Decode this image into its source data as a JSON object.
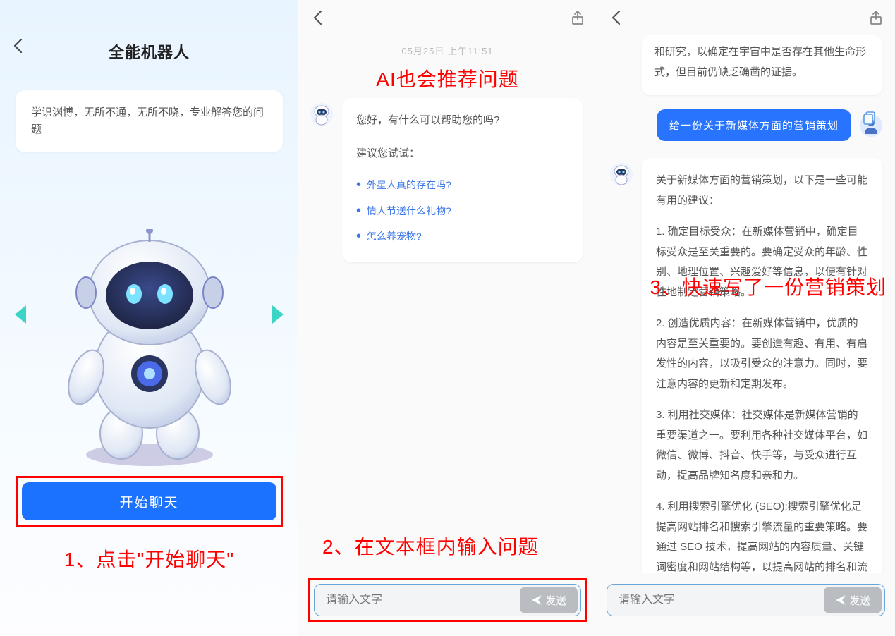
{
  "panel1": {
    "title": "全能机器人",
    "description": "学识渊博，无所不通，无所不晓，专业解答您的问题",
    "start_button": "开始聊天",
    "annotation": "1、点击\"开始聊天\""
  },
  "panel2": {
    "timestamp": "05月25日  上午11:51",
    "annotation_top": "AI也会推荐问题",
    "greeting": "您好，有什么可以帮助您的吗?",
    "try_label": "建议您试试：",
    "suggestions": [
      "外星人真的存在吗?",
      "情人节送什么礼物?",
      "怎么养宠物?"
    ],
    "annotation_bottom": "2、在文本框内输入问题",
    "input_placeholder": "请输入文字",
    "send_label": "发送"
  },
  "panel3": {
    "ai_partial_top": "和研究，以确定在宇宙中是否存在其他生命形式，但目前仍缺乏确凿的证据。",
    "user_message": "给一份关于新媒体方面的营销策划",
    "ai_intro": "关于新媒体方面的营销策划，以下是一些可能有用的建议：",
    "ai_points": [
      "1. 确定目标受众：在新媒体营销中，确定目标受众是至关重要的。要确定受众的年龄、性别、地理位置、兴趣爱好等信息，以便有针对性地制定营销策略。",
      "2. 创造优质内容：在新媒体营销中，优质的内容是至关重要的。要创造有趣、有用、有启发性的内容，以吸引受众的注意力。同时，要注意内容的更新和定期发布。",
      "3. 利用社交媒体：社交媒体是新媒体营销的重要渠道之一。要利用各种社交媒体平台，如微信、微博、抖音、快手等，与受众进行互动，提高品牌知名度和亲和力。",
      "4. 利用搜索引擎优化 (SEO):搜索引擎优化是提高网站排名和搜索引擎流量的重要策略。要通过 SEO 技术，提高网站的内容质量、关键词密度和网站结构等，以提高网站的排名和流量。"
    ],
    "annotation": "3、快速写了一份营销策划",
    "input_placeholder": "请输入文字",
    "send_label": "发送"
  }
}
